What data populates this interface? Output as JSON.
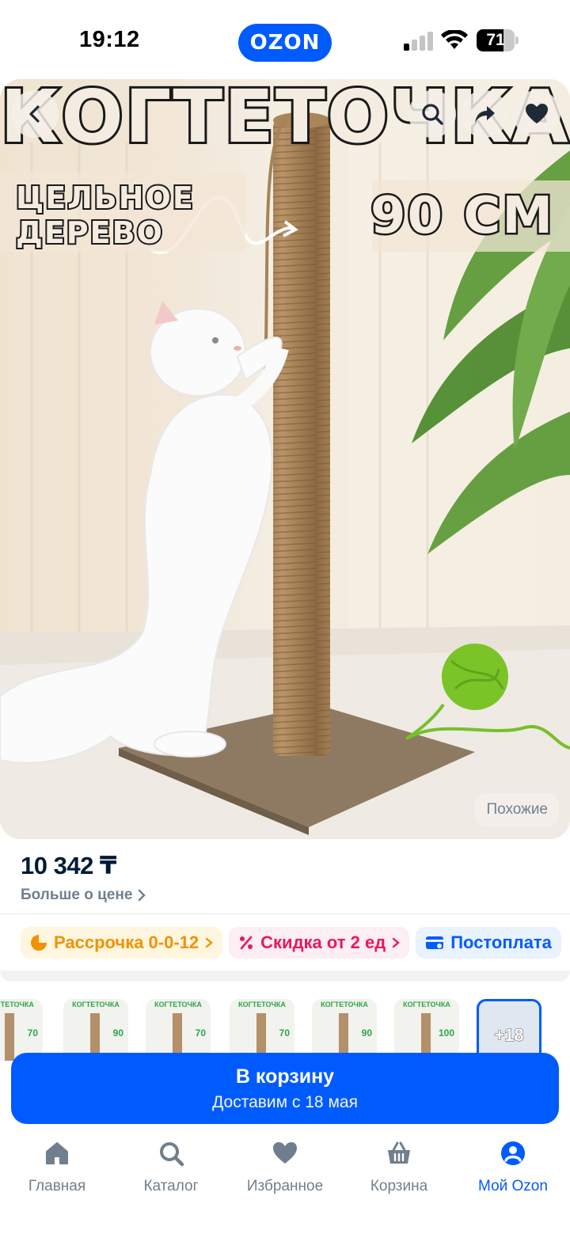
{
  "status_bar": {
    "time": "19:12",
    "brand": "OZON",
    "battery": "71",
    "battery_level": 0.71
  },
  "hero": {
    "title": "КОГТЕТОЧКА",
    "left_caption_line1": "ЦЕЛЬНОЕ",
    "left_caption_line2": "ДЕРЕВО",
    "right_caption": "90 СМ",
    "similar_label": "Похожие"
  },
  "price": {
    "value": "10 342 ₸",
    "more_label": "Больше о цене"
  },
  "chips": [
    {
      "label": "Рассрочка 0-0-12"
    },
    {
      "label": "Скидка от 2 ед"
    },
    {
      "label": "Постоплата"
    }
  ],
  "thumbnails": [
    {
      "title": "КОГТЕТОЧКА",
      "num": "70"
    },
    {
      "title": "КОГТЕТОЧКА",
      "num": "90"
    },
    {
      "title": "КОГТЕТОЧКА",
      "num": "70"
    },
    {
      "title": "КОГТЕТОЧКА",
      "num": "70"
    },
    {
      "title": "КОГТЕТОЧКА",
      "num": "90"
    },
    {
      "title": "КОГТЕТОЧКА",
      "num": "100"
    },
    {
      "title": "",
      "num": "+18"
    }
  ],
  "cart": {
    "label": "В корзину",
    "delivery": "Доставим с 18 мая"
  },
  "bottom_nav": [
    {
      "label": "Главная",
      "icon": "home-icon"
    },
    {
      "label": "Каталог",
      "icon": "search-icon"
    },
    {
      "label": "Избранное",
      "icon": "heart-icon"
    },
    {
      "label": "Корзина",
      "icon": "basket-icon"
    },
    {
      "label": "Мой Ozon",
      "icon": "profile-icon"
    }
  ],
  "colors": {
    "accent": "#005bff",
    "muted": "#707f8d"
  }
}
